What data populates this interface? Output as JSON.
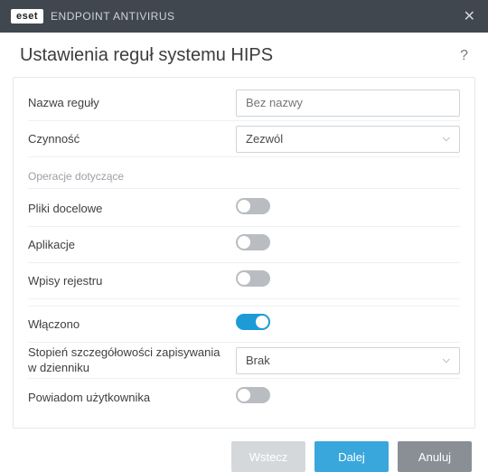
{
  "titlebar": {
    "badge_brand": "eset",
    "product_name": "ENDPOINT ANTIVIRUS"
  },
  "header": {
    "title": "Ustawienia reguł systemu HIPS",
    "help_symbol": "?"
  },
  "fields": {
    "rule_name": {
      "label": "Nazwa reguły",
      "placeholder": "Bez nazwy",
      "value": ""
    },
    "action": {
      "label": "Czynność",
      "selected": "Zezwól"
    },
    "section_ops": "Operacje dotyczące",
    "target_files": {
      "label": "Pliki docelowe",
      "on": false
    },
    "applications": {
      "label": "Aplikacje",
      "on": false
    },
    "registry": {
      "label": "Wpisy rejestru",
      "on": false
    },
    "enabled": {
      "label": "Włączono",
      "on": true
    },
    "log_detail": {
      "label": "Stopień szczegółowości zapisywania w dzienniku",
      "selected": "Brak"
    },
    "notify_user": {
      "label": "Powiadom użytkownika",
      "on": false
    }
  },
  "footer": {
    "back": "Wstecz",
    "next": "Dalej",
    "cancel": "Anuluj"
  }
}
